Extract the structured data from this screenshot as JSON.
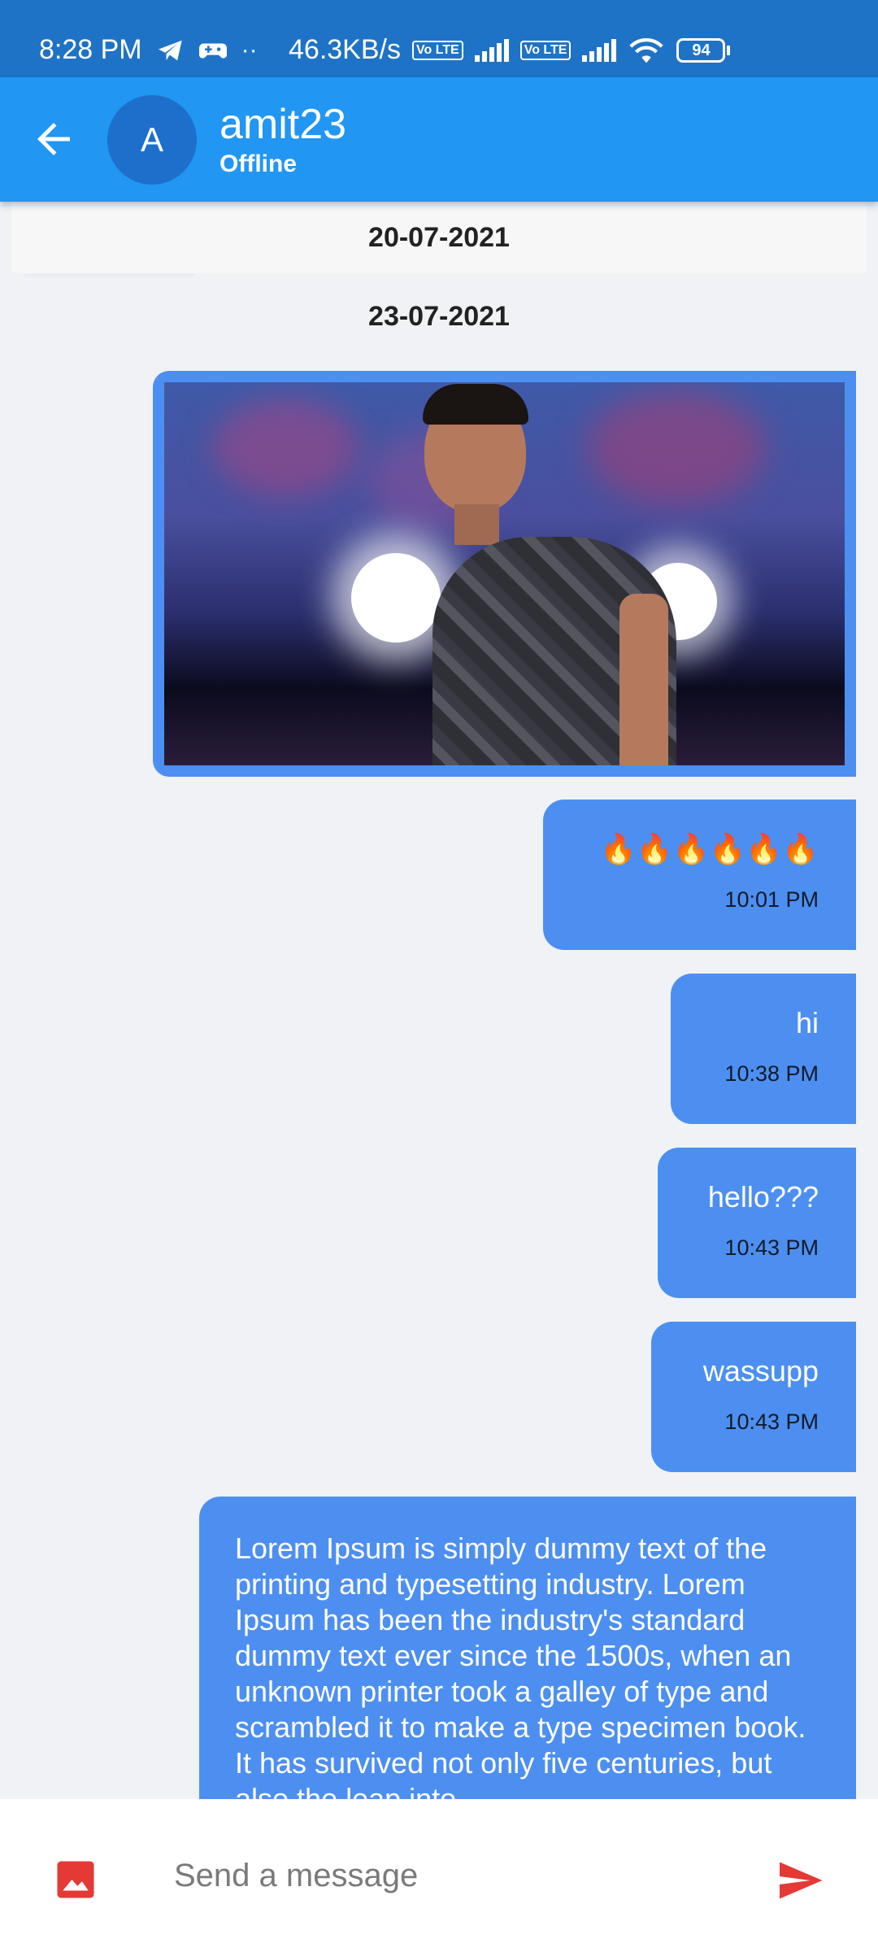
{
  "status_bar": {
    "time": "8:28 PM",
    "net_speed": "46.3KB/s",
    "lte_label": "Vo LTE",
    "battery": "94"
  },
  "header": {
    "avatar_letter": "A",
    "name": "amit23",
    "status": "Offline"
  },
  "dates": [
    "20-07-2021",
    "23-07-2021"
  ],
  "messages": [
    {
      "text": "🔥🔥🔥🔥🔥🔥",
      "time": "10:01 PM"
    },
    {
      "text": "hi",
      "time": "10:38 PM"
    },
    {
      "text": "hello???",
      "time": "10:43 PM"
    },
    {
      "text": "wassupp",
      "time": "10:43 PM"
    },
    {
      "text": "Lorem Ipsum is simply dummy text of the printing and typesetting industry. Lorem Ipsum has been the industry's standard dummy text ever since the 1500s, when an unknown printer took a galley of type and scrambled it to make a type specimen book. It has survived not only five centuries, but also the leap into"
    }
  ],
  "composer": {
    "placeholder": "Send a message"
  },
  "colors": {
    "status_bar": "#1e73c7",
    "app_bar": "#2196f3",
    "bubble": "#4d8ff0",
    "icon_red": "#e53935",
    "background": "#f1f2f6"
  }
}
